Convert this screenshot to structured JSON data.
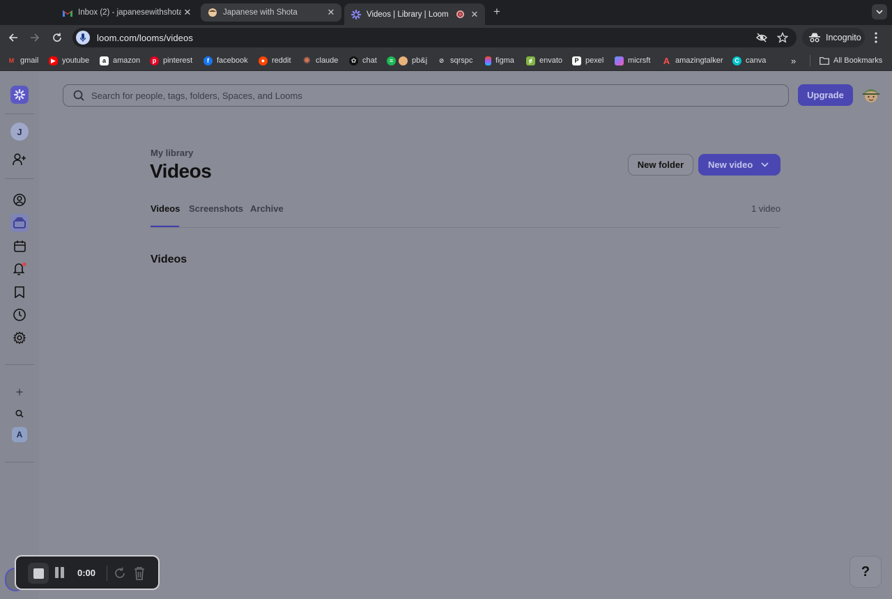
{
  "browser": {
    "tabs": [
      {
        "title": "Inbox (2) - japanesewithshota",
        "favicon": "gmail-icon"
      },
      {
        "title": "Japanese with Shota",
        "favicon": "site-icon"
      },
      {
        "title": "Videos | Library | Loom",
        "favicon": "loom-icon",
        "active": true
      }
    ],
    "url": "loom.com/looms/videos",
    "incognito_label": "Incognito",
    "bookmarks": [
      {
        "label": "gmail",
        "color": "#ea4335"
      },
      {
        "label": "youtube",
        "color": "#ff0000"
      },
      {
        "label": "amazon",
        "color": "#ffffff"
      },
      {
        "label": "pinterest",
        "color": "#e60023"
      },
      {
        "label": "facebook",
        "color": "#1877f2"
      },
      {
        "label": "reddit",
        "color": "#ff4500"
      },
      {
        "label": "claude",
        "color": "#d97757"
      },
      {
        "label": "chat",
        "color": "#111111"
      },
      {
        "label": "pb&j",
        "color": "#1db954"
      },
      {
        "label": "sqrspc",
        "color": "#222222"
      },
      {
        "label": "figma",
        "color": "#a259ff"
      },
      {
        "label": "envato",
        "color": "#82b541"
      },
      {
        "label": "pexel",
        "color": "#ffffff"
      },
      {
        "label": "micrsft",
        "color": "#7f6df2"
      },
      {
        "label": "amazingtalker",
        "color": "#ff4d4d"
      },
      {
        "label": "canva",
        "color": "#00c4cc"
      }
    ],
    "all_bookmarks_label": "All Bookmarks"
  },
  "sidebar": {
    "workspace_initial": "J",
    "bottom_initial": "A"
  },
  "search": {
    "placeholder": "Search for people, tags, folders, Spaces, and Looms"
  },
  "header": {
    "upgrade_label": "Upgrade"
  },
  "main": {
    "breadcrumb": "My library",
    "title": "Videos",
    "new_folder_label": "New folder",
    "new_video_label": "New video",
    "tabs": [
      {
        "label": "Videos",
        "active": true
      },
      {
        "label": "Screenshots"
      },
      {
        "label": "Archive"
      }
    ],
    "count": "1 video",
    "section_title": "Videos"
  },
  "help_label": "?",
  "recorder": {
    "time": "0:00"
  },
  "colors": {
    "accent": "#4a47b2",
    "page_bg": "#898b96"
  }
}
